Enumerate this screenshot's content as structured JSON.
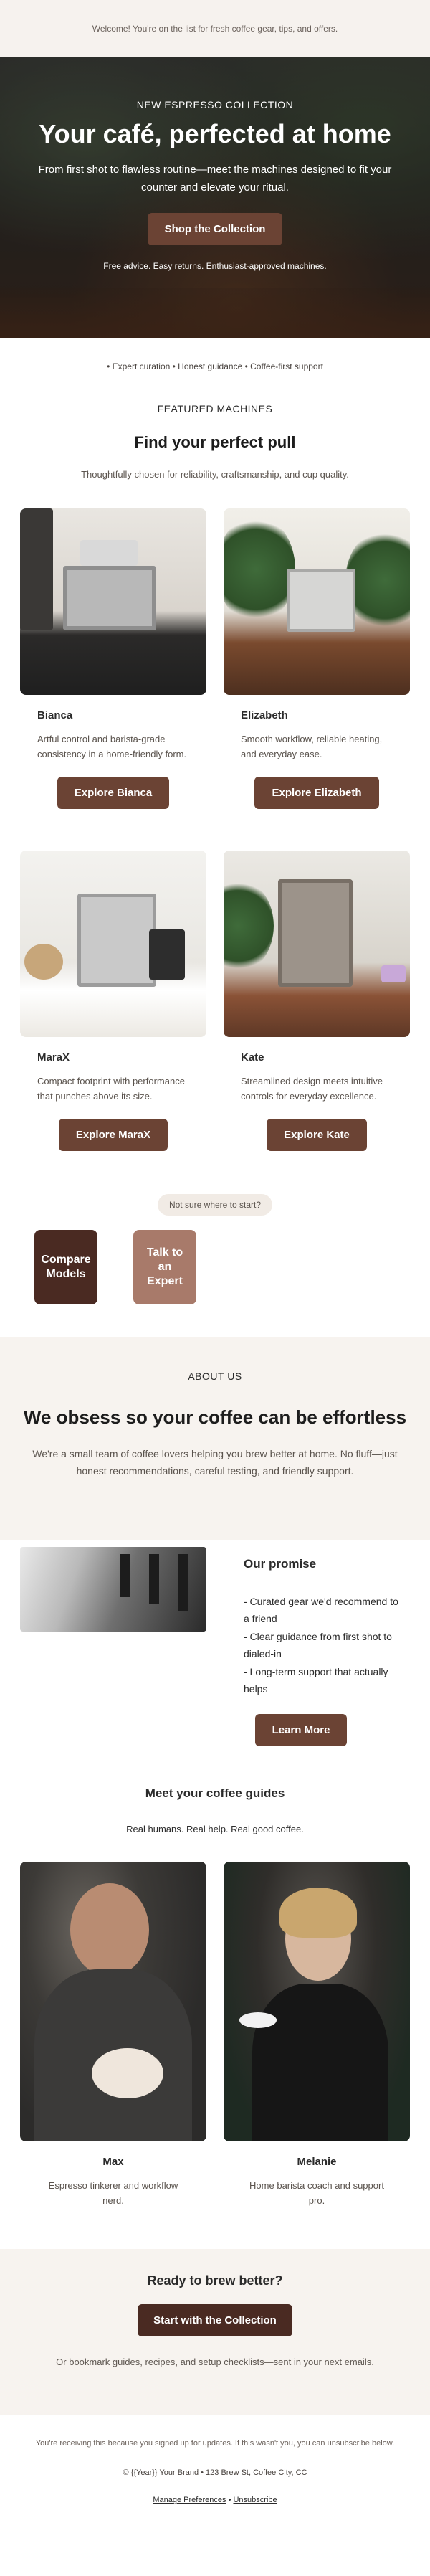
{
  "preheader": {
    "text": "Welcome! You're on the list for fresh coffee gear, tips, and offers."
  },
  "hero": {
    "eyebrow": "NEW ESPRESSO COLLECTION",
    "title": "Your café, perfected at home",
    "subtitle": "From first shot to flawless routine—meet the machines designed to fit your counter and elevate your ritual.",
    "cta": "Shop the Collection",
    "note": "Free advice. Easy returns. Enthusiast-approved machines."
  },
  "trust": {
    "text": "• Expert curation • Honest guidance • Coffee-first support"
  },
  "featured": {
    "eyebrow": "FEATURED MACHINES",
    "title": "Find your perfect pull",
    "subtitle": "Thoughtfully chosen for reliability, craftsmanship, and cup quality.",
    "products": [
      {
        "name": "Bianca",
        "desc": "Artful control and barista-grade consistency in a home-friendly form.",
        "cta": "Explore Bianca"
      },
      {
        "name": "Elizabeth",
        "desc": "Smooth workflow, reliable heating, and everyday ease.",
        "cta": "Explore Elizabeth"
      },
      {
        "name": "MaraX",
        "desc": "Compact footprint with performance that punches above its size.",
        "cta": "Explore MaraX"
      },
      {
        "name": "Kate",
        "desc": "Streamlined design meets intuitive controls for everyday excellence.",
        "cta": "Explore Kate"
      }
    ]
  },
  "helper": {
    "pill": "Not sure where to start?",
    "compare": "Compare Models",
    "talk": "Talk to an Expert",
    "compare_color": "#4a2a22",
    "talk_color": "#a87a6a"
  },
  "about": {
    "eyebrow": "ABOUT US",
    "title": "We obsess so your coffee can be effortless",
    "body": "We're a small team of coffee lovers helping you brew better at home. No fluff—just honest recommendations, careful testing, and friendly support."
  },
  "promise": {
    "title": "Our promise",
    "items": [
      "- Curated gear we'd recommend to a friend",
      "- Clear guidance from first shot to dialed-in",
      "- Long-term support that actually helps"
    ],
    "cta": "Learn More"
  },
  "guides": {
    "title": "Meet your coffee guides",
    "subtitle": "Real humans. Real help. Real good coffee.",
    "people": [
      {
        "name": "Max",
        "desc": "Espresso tinkerer and workflow nerd."
      },
      {
        "name": "Melanie",
        "desc": "Home barista coach and support pro."
      }
    ]
  },
  "cta": {
    "title": "Ready to brew better?",
    "button": "Start with the Collection",
    "note": "Or bookmark guides, recipes, and setup checklists—sent in your next emails."
  },
  "footer": {
    "reason": "You're receiving this because you signed up for updates. If this wasn't you, you can unsubscribe below.",
    "address": "© {{Year}} Your Brand • 123 Brew St, Coffee City, CC",
    "manage": "Manage Preferences",
    "separator": "•",
    "unsubscribe": "Unsubscribe"
  },
  "colors": {
    "accent": "#6b4334",
    "dark_accent": "#4a2a22",
    "cream": "#f7f3ef"
  }
}
